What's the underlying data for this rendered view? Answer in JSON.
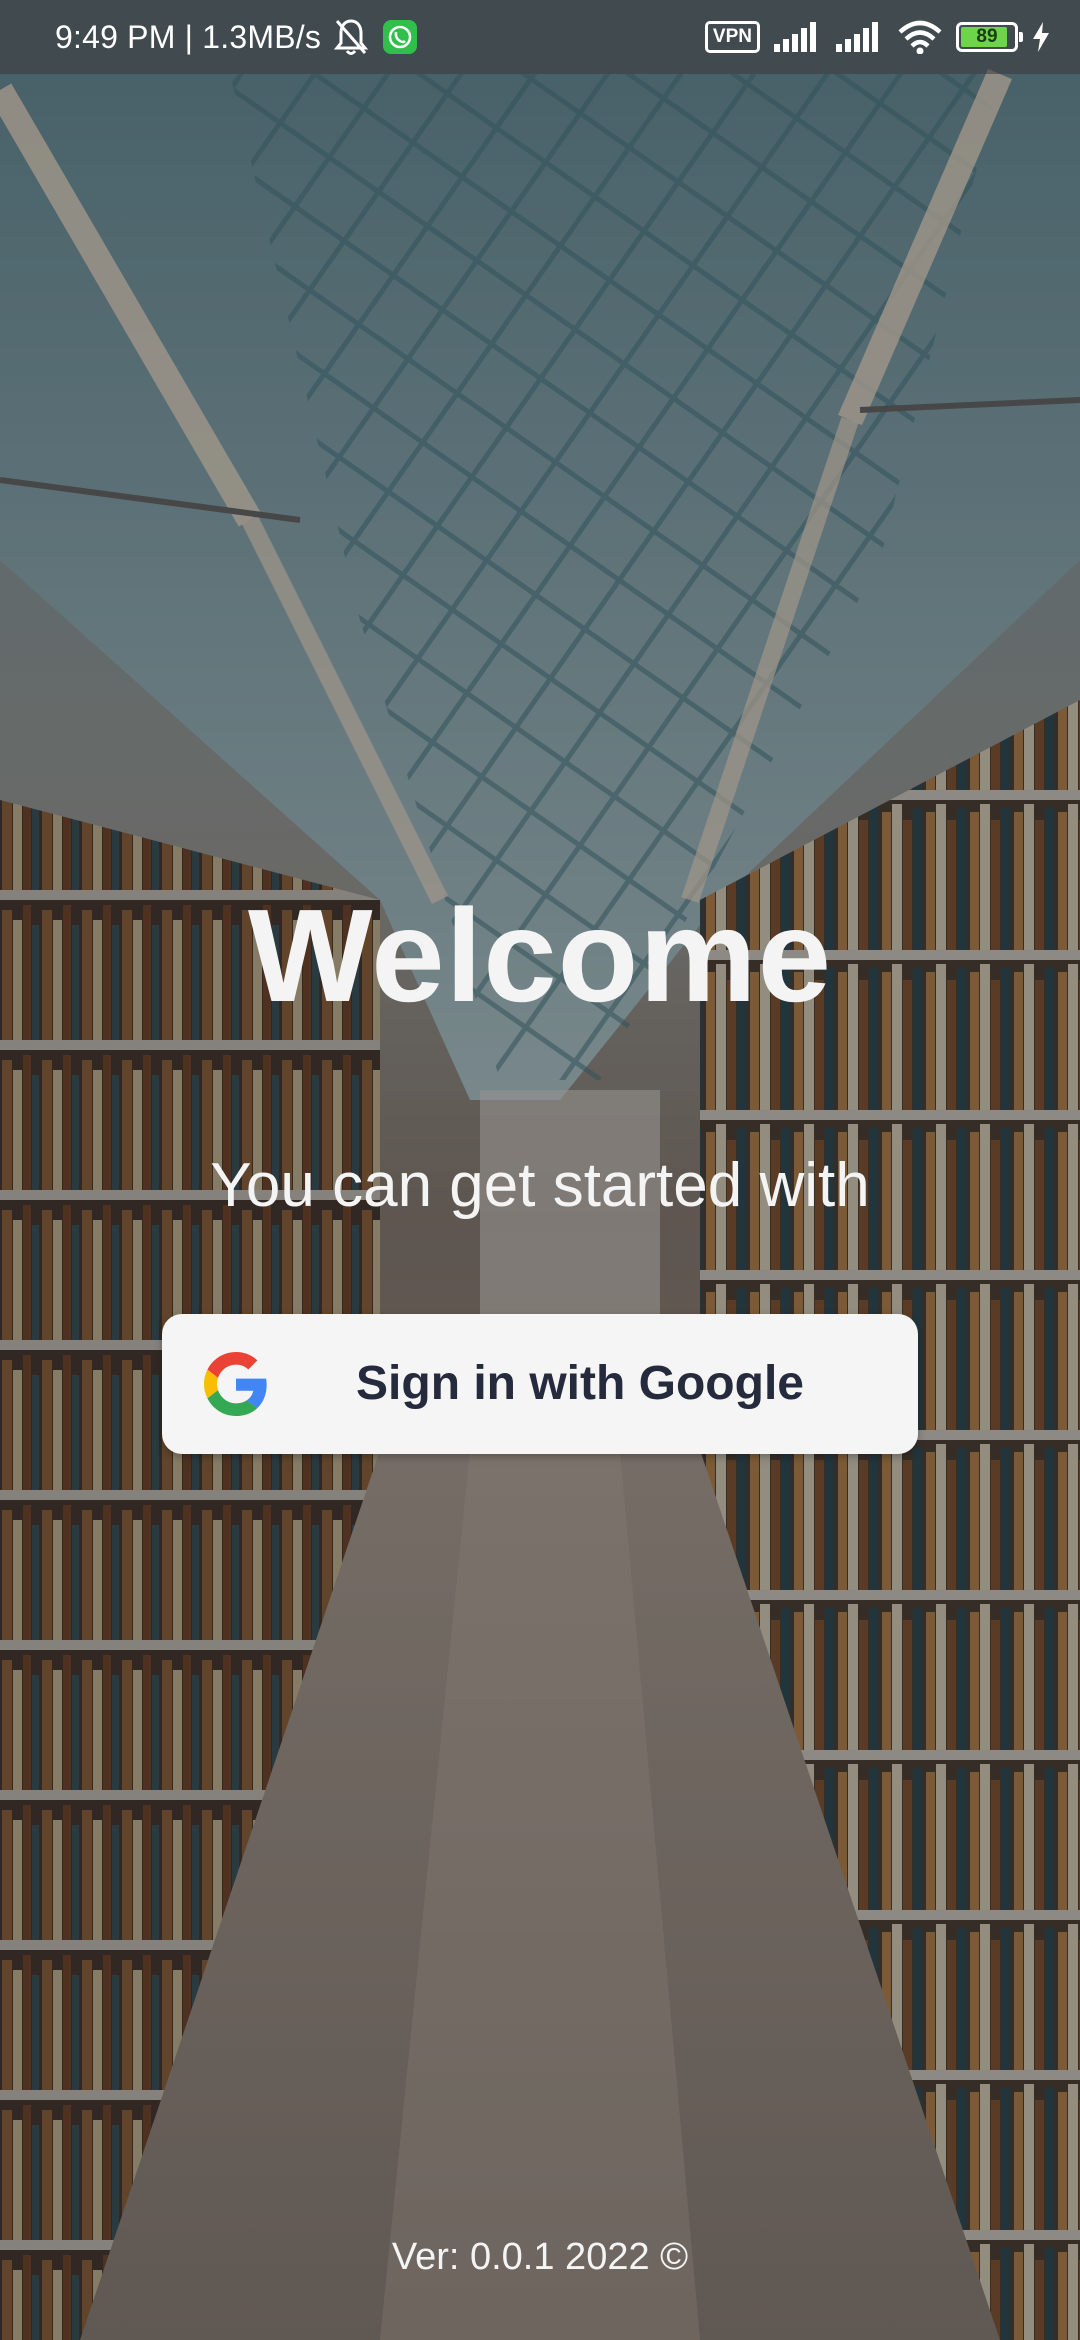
{
  "status_bar": {
    "time_speed": "9:49 PM | 1.3MB/s",
    "vpn_label": "VPN",
    "battery_level": "89",
    "battery_fraction": 0.89
  },
  "main": {
    "title": "Welcome",
    "subtitle": "You can get started with",
    "google_button_label": "Sign in with Google",
    "version": "Ver: 0.0.1 2022 ©"
  },
  "colors": {
    "button_bg": "#f5f5f5",
    "button_text": "#252a3d",
    "text": "#f4f4f4",
    "battery_fill": "#6ed44a"
  },
  "icons": {
    "status": [
      "bell-muted-icon",
      "whatsapp-icon",
      "vpn-icon",
      "signal-icon",
      "signal-icon",
      "wifi-icon",
      "battery-icon",
      "charging-icon"
    ],
    "button": "google-logo-icon"
  }
}
